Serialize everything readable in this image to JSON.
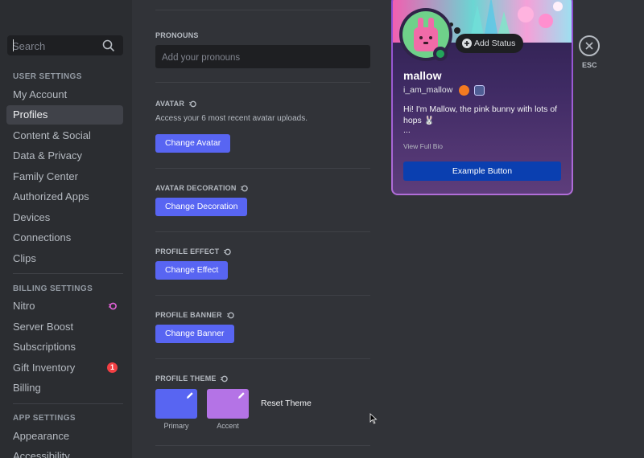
{
  "sidebar": {
    "search_placeholder": "Search",
    "user_settings_title": "User Settings",
    "user_items": [
      {
        "label": "My Account"
      },
      {
        "label": "Profiles"
      },
      {
        "label": "Content & Social"
      },
      {
        "label": "Data & Privacy"
      },
      {
        "label": "Family Center"
      },
      {
        "label": "Authorized Apps"
      },
      {
        "label": "Devices"
      },
      {
        "label": "Connections"
      },
      {
        "label": "Clips"
      }
    ],
    "billing_title": "Billing Settings",
    "billing_items": [
      {
        "label": "Nitro"
      },
      {
        "label": "Server Boost"
      },
      {
        "label": "Subscriptions"
      },
      {
        "label": "Gift Inventory",
        "badge": "1"
      },
      {
        "label": "Billing"
      }
    ],
    "app_title": "App Settings",
    "app_items": [
      {
        "label": "Appearance"
      },
      {
        "label": "Accessibility"
      }
    ]
  },
  "content": {
    "pronouns_label": "Pronouns",
    "pronouns_placeholder": "Add your pronouns",
    "avatar_label": "Avatar",
    "avatar_desc": "Access your 6 most recent avatar uploads.",
    "avatar_button": "Change Avatar",
    "decoration_label": "Avatar Decoration",
    "decoration_button": "Change Decoration",
    "effect_label": "Profile Effect",
    "effect_button": "Change Effect",
    "banner_label": "Profile Banner",
    "banner_button": "Change Banner",
    "theme_label": "Profile Theme",
    "primary_label": "Primary",
    "accent_label": "Accent",
    "primary_color": "#5865f2",
    "accent_color": "#b473e6",
    "reset_label": "Reset Theme"
  },
  "card": {
    "add_status": "Add Status",
    "display_name": "mallow",
    "username": "i_am_mallow",
    "bio_line": "Hi! I'm Mallow, the pink bunny with lots of hops 🐰",
    "bio_more": "...",
    "view_full_bio": "View Full Bio",
    "example_button": "Example Button"
  },
  "close": {
    "label": "ESC"
  }
}
